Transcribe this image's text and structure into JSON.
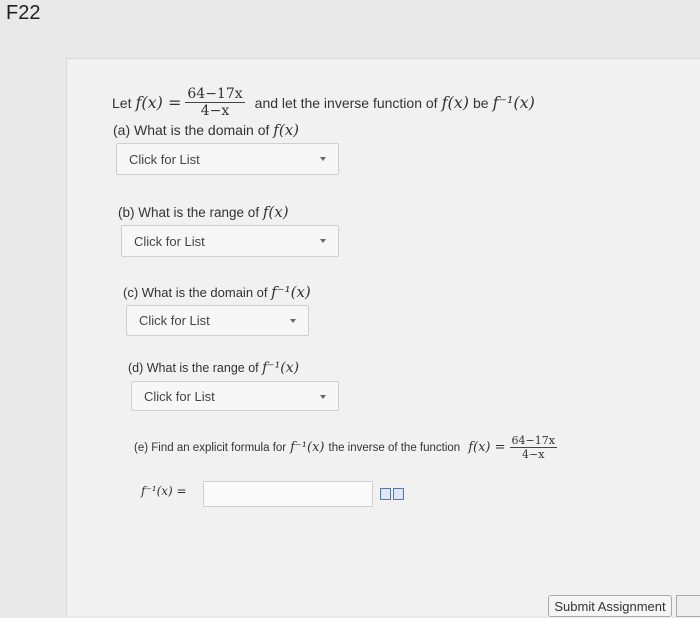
{
  "header": {
    "label": "F22"
  },
  "problem": {
    "intro_let": "Let",
    "func": "f(x) =",
    "numerator": "64−17x",
    "denominator": "4−x",
    "intro_rest": "and let the inverse function of",
    "fx": "f(x)",
    "be": "be",
    "finv": "f⁻¹(x)"
  },
  "parts": {
    "a": {
      "question": "(a) What is the domain of",
      "math": "f(x)",
      "select_value": "Click for List"
    },
    "b": {
      "question": "(b) What is the range of",
      "math": "f(x)",
      "select_value": "Click for List"
    },
    "c": {
      "question": "(c) What is the domain of",
      "math": "f⁻¹(x)",
      "select_value": "Click for List"
    },
    "d": {
      "question": "(d) What is the range of",
      "math": "f⁻¹(x)",
      "select_value": "Click for List"
    },
    "e": {
      "question": "(e) Find an explicit formula for",
      "math1": "f⁻¹(x)",
      "question_rest": "the inverse of the function",
      "math2": "f(x) =",
      "numerator": "64−17x",
      "denominator": "4−x",
      "answer_label": "f⁻¹(x) =",
      "answer_value": ""
    }
  },
  "footer": {
    "submit_label": "Submit Assignment"
  }
}
